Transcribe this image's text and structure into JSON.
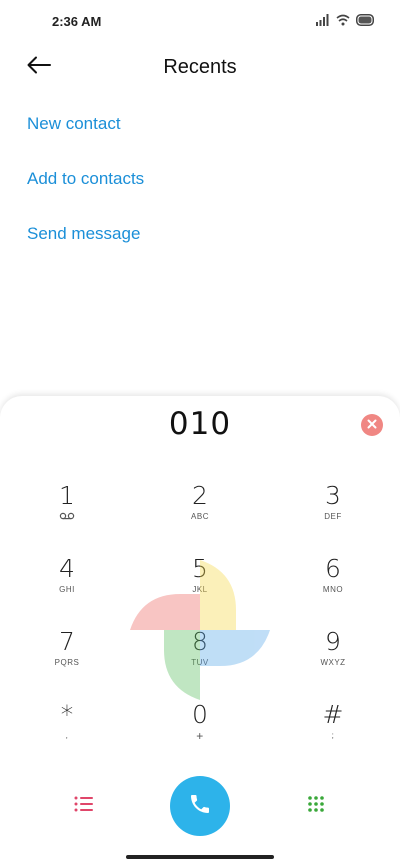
{
  "status_bar": {
    "time": "2:36 AM"
  },
  "header": {
    "title": "Recents"
  },
  "actions": [
    {
      "label": "New contact"
    },
    {
      "label": "Add to contacts"
    },
    {
      "label": "Send message"
    }
  ],
  "dialer": {
    "number": "010",
    "keys": [
      {
        "digit": "1",
        "letters": ""
      },
      {
        "digit": "2",
        "letters": "ABC"
      },
      {
        "digit": "3",
        "letters": "DEF"
      },
      {
        "digit": "4",
        "letters": "GHI"
      },
      {
        "digit": "5",
        "letters": "JKL"
      },
      {
        "digit": "6",
        "letters": "MNO"
      },
      {
        "digit": "7",
        "letters": "PQRS"
      },
      {
        "digit": "8",
        "letters": "TUV"
      },
      {
        "digit": "9",
        "letters": "WXYZ"
      },
      {
        "digit": "*",
        "letters": ","
      },
      {
        "digit": "0",
        "letters": "+"
      },
      {
        "digit": "#",
        "letters": ";"
      }
    ]
  },
  "colors": {
    "accent": "#1b8fd8",
    "call_button": "#2db3ea",
    "clear_button": "#f08783",
    "recents_icon": "#e0466a",
    "dialpad_icon": "#3aa83a"
  },
  "icons": {
    "back": "arrow-left-icon",
    "clear": "close-circle-icon",
    "call": "phone-icon",
    "recents": "list-icon",
    "dialpad": "dialpad-grid-icon",
    "voicemail": "voicemail-icon",
    "signal": "signal-icon",
    "wifi": "wifi-icon",
    "battery": "battery-icon"
  }
}
